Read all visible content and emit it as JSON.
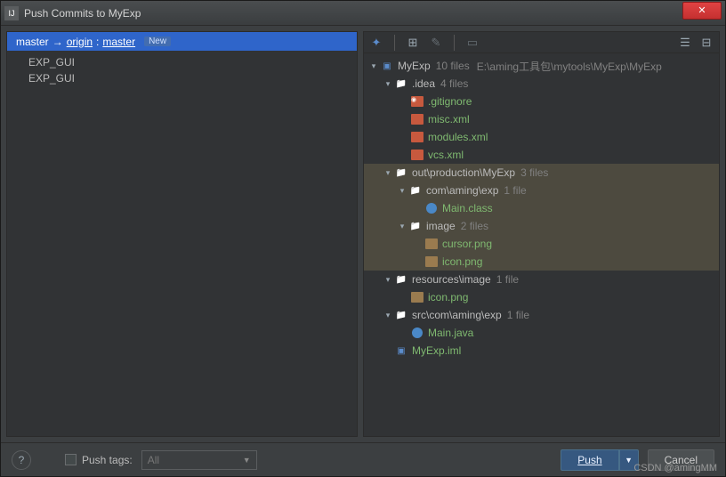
{
  "window": {
    "title": "Push Commits to MyExp"
  },
  "left": {
    "branch": {
      "local": "master",
      "arrow": "→",
      "remote": "origin",
      "sep": ":",
      "remote_branch": "master",
      "badge": "New"
    },
    "commits": [
      "EXP_GUI",
      "EXP_GUI"
    ]
  },
  "tree": {
    "root": {
      "name": "MyExp",
      "meta": "10 files",
      "path": "E:\\aming工具包\\mytools\\MyExp\\MyExp"
    },
    "idea": {
      "name": ".idea",
      "meta": "4 files",
      "files": [
        {
          "n": ".gitignore"
        },
        {
          "n": "misc.xml"
        },
        {
          "n": "modules.xml"
        },
        {
          "n": "vcs.xml"
        }
      ]
    },
    "out": {
      "name": "out\\production\\MyExp",
      "meta": "3 files"
    },
    "com": {
      "name": "com\\aming\\exp",
      "meta": "1 file",
      "files": [
        {
          "n": "Main.class"
        }
      ]
    },
    "image": {
      "name": "image",
      "meta": "2 files",
      "files": [
        {
          "n": "cursor.png"
        },
        {
          "n": "icon.png"
        }
      ]
    },
    "res": {
      "name": "resources\\image",
      "meta": "1 file",
      "files": [
        {
          "n": "icon.png"
        }
      ]
    },
    "src": {
      "name": "src\\com\\aming\\exp",
      "meta": "1 file",
      "files": [
        {
          "n": "Main.java"
        }
      ]
    },
    "iml": {
      "n": "MyExp.iml"
    }
  },
  "footer": {
    "help": "?",
    "push_tags_label": "Push tags:",
    "combo_value": "All",
    "push_btn": "Push",
    "cancel_btn": "Cancel"
  },
  "watermark": "CSDN @amingMM"
}
